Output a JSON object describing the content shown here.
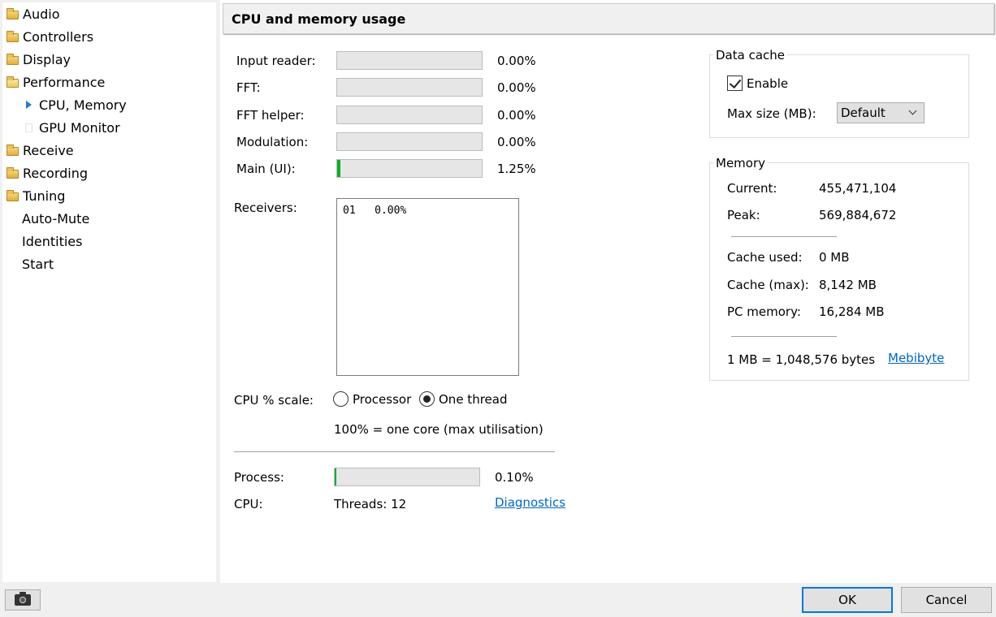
{
  "sidebar": {
    "items": [
      {
        "label": "Audio",
        "icon": "folder-icon"
      },
      {
        "label": "Controllers",
        "icon": "folder-icon"
      },
      {
        "label": "Display",
        "icon": "folder-icon"
      },
      {
        "label": "Performance",
        "icon": "folder-open-icon"
      },
      {
        "label": "CPU, Memory",
        "icon": "selected-arrow-icon"
      },
      {
        "label": "GPU Monitor",
        "icon": "blank-page-icon"
      },
      {
        "label": "Receive",
        "icon": "folder-icon"
      },
      {
        "label": "Recording",
        "icon": "folder-icon"
      },
      {
        "label": "Tuning",
        "icon": "folder-icon"
      },
      {
        "label": "Auto-Mute"
      },
      {
        "label": "Identities"
      },
      {
        "label": "Start"
      }
    ]
  },
  "header": {
    "title": "CPU and memory usage"
  },
  "cpu": {
    "rows": [
      {
        "label": "Input reader:",
        "value": "0.00%",
        "fill": 0.0
      },
      {
        "label": "FFT:",
        "value": "0.00%",
        "fill": 0.0
      },
      {
        "label": "FFT helper:",
        "value": "0.00%",
        "fill": 0.0
      },
      {
        "label": "Modulation:",
        "value": "0.00%",
        "fill": 0.0
      },
      {
        "label": "Main (UI):",
        "value": "1.25%",
        "fill": 0.0125
      }
    ],
    "receivers_label": "Receivers:",
    "receivers_list": [
      {
        "id": "01",
        "value": "0.00%"
      }
    ],
    "scale_label": "CPU % scale:",
    "scale_options": [
      "Processor",
      "One thread"
    ],
    "scale_selected": "One thread",
    "scale_note": "100% = one core (max utilisation)",
    "process_label": "Process:",
    "process_value": "0.10%",
    "process_fill": 0.001,
    "cpu_label": "CPU:",
    "threads": "Threads: 12",
    "diagnostics_link": "Diagnostics"
  },
  "data_cache": {
    "title": "Data cache",
    "enable_label": "Enable",
    "enabled": true,
    "max_size_label": "Max size (MB):",
    "max_size_value": "Default"
  },
  "memory": {
    "title": "Memory",
    "current_label": "Current:",
    "current_value": "455,471,104",
    "peak_label": "Peak:",
    "peak_value": "569,884,672",
    "cache_used_label": "Cache used:",
    "cache_used_value": "0 MB",
    "cache_max_label": "Cache (max):",
    "cache_max_value": "8,142 MB",
    "pc_memory_label": "PC memory:",
    "pc_memory_value": "16,284 MB",
    "mb_note": "1 MB = 1,048,576 bytes",
    "mebibyte_link": "Mebibyte"
  },
  "footer": {
    "ok_label": "OK",
    "cancel_label": "Cancel"
  },
  "colors": {
    "progress_fill": "#06b025",
    "link": "#0066cc",
    "selected_arrow": "#2b78c5",
    "default_button_border": "#0078d7"
  }
}
